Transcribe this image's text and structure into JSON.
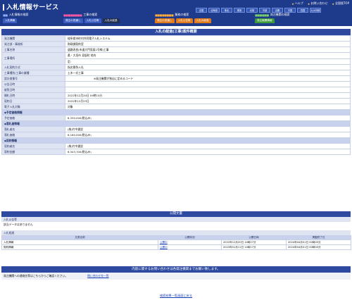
{
  "header": {
    "site_title": "入札情報サービス",
    "toplinks": [
      "ヘルプ",
      "お問い合わせ",
      "全国版TOP"
    ],
    "regions_row1": [
      "全国",
      "北海道",
      "東北",
      "関東",
      "北陸",
      "中部",
      "近畿",
      "中国",
      "四国",
      "九州沖縄"
    ],
    "categories": [
      {
        "title": "入札情報の検索",
        "color": "#ffffff",
        "tabs": [
          "入札情報",
          "入札結果"
        ],
        "tab_color": "#3a5cc0"
      },
      {
        "title": "工事の検索",
        "color": "#ffffff",
        "tabs": [
          "発注の見通し",
          "入札公告等",
          "入札の経過"
        ],
        "tab_color": "#22304f"
      },
      {
        "title": "業務の検索",
        "color": "#ffffff",
        "tabs": [
          "発注の見通し",
          "入札公告等",
          "入札の経過"
        ],
        "tab_color": "#e07a1c"
      },
      {
        "title": "発注機関の検索",
        "color": "#ffffff",
        "tabs": [
          "発注機関情報"
        ],
        "tab_color": "#3c9a3a"
      }
    ]
  },
  "detail": {
    "panel_title": "入札の経過(工事)案件概要",
    "rows": [
      {
        "k": "発注機関",
        "v": "岐阜県市町村共同電子入札システム"
      },
      {
        "k": "発注部・事務所",
        "v": "財政課契約室"
      },
      {
        "k": "工事名称",
        "v": "道路改良(市道大門見坂1号線)工事"
      },
      {
        "k": "工事場所",
        "v": "県・大垣市  見坂町  地内",
        "v2": "定:"
      },
      {
        "k": "入札契約方式",
        "v": "指名競争入札"
      },
      {
        "k": "工事種別/工事の業種",
        "v": "土木一式工事"
      },
      {
        "k": "設計書番号",
        "v": "※発注機関が独自に定めるコード"
      },
      {
        "k": "公告日時",
        "v": ""
      },
      {
        "k": "縦覧日時",
        "v": ""
      },
      {
        "k": "開札日時",
        "v": "2022年12月20日 09時15分"
      },
      {
        "k": "契約日",
        "v": "2022年12月23日"
      },
      {
        "k": "電子入札対象",
        "v": "対象"
      }
    ],
    "section_price": "◆予定価格情報",
    "price_rows": [
      {
        "k": "予定価格",
        "v": "6,330,000(税込み)"
      }
    ],
    "section_winner": "◆落札者情報",
    "winner_rows": [
      {
        "k": "落札者名",
        "v": "(株)竹中建設"
      },
      {
        "k": "落札価格",
        "v": "6,160,000(税込み)"
      }
    ],
    "section_contract": "◆契約情報",
    "contract_rows": [
      {
        "k": "契約者名",
        "v": "(株)竹中建設"
      },
      {
        "k": "契約金額",
        "v": "6,343,700(税込み)"
      }
    ]
  },
  "docs": {
    "title": "公開文書",
    "notice_label": "入札公告等",
    "notice_value": "該当データはありません",
    "progress_label": "入札経過",
    "columns": [
      "文書名称",
      "公開状況",
      "公開日時",
      "掲載終了日"
    ],
    "rows": [
      {
        "name": "入札情報",
        "status": "公開中",
        "published": "2022年12月20日 14時27分",
        "end": "2024年04月01日 00時00分"
      },
      {
        "name": "契約情報",
        "status": "公開中",
        "published": "2023年01月11日 14時17分",
        "end": "2024年04月01日 00時00分"
      }
    ]
  },
  "contact": {
    "title": "内容に関するお問い合わせは各発注機関までお願い致します。",
    "body": "発注機関への連絡先等はこちらからご確認ください。",
    "link": "問い合わせ先一覧"
  },
  "back_link": "検索結果一覧画面に戻る"
}
